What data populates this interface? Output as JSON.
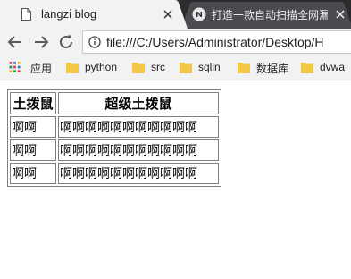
{
  "browser": {
    "tabs": [
      {
        "title": "langzi blog",
        "active": true
      },
      {
        "title": "打造一款自动扫描全网漏洞",
        "active": false
      }
    ],
    "address": {
      "url": "file:///C:/Users/Administrator/Desktop/H"
    },
    "bookmarks": [
      {
        "label": "应用",
        "icon": "apps-icon"
      },
      {
        "label": "python",
        "icon": "folder-icon"
      },
      {
        "label": "src",
        "icon": "folder-icon"
      },
      {
        "label": "sqlin",
        "icon": "folder-icon"
      },
      {
        "label": "数据库",
        "icon": "folder-icon"
      },
      {
        "label": "dvwa",
        "icon": "folder-icon"
      }
    ]
  },
  "page": {
    "table": {
      "headers": [
        "土拨鼠",
        "超级土拨鼠"
      ],
      "rows": [
        [
          "啊啊",
          "啊啊啊啊啊啊啊啊啊啊啊"
        ],
        [
          "啊啊",
          "啊啊啊啊啊啊啊啊啊啊啊"
        ],
        [
          "啊啊",
          "啊啊啊啊啊啊啊啊啊啊啊"
        ]
      ]
    }
  },
  "colors": {
    "tabstrip": "#2b2c2e",
    "active_tab": "#f2f2f2",
    "inactive_tab": "#4a4b4e",
    "toolbar": "#f2f2f2",
    "folder": "#f3c844",
    "table_border": "#808080"
  }
}
